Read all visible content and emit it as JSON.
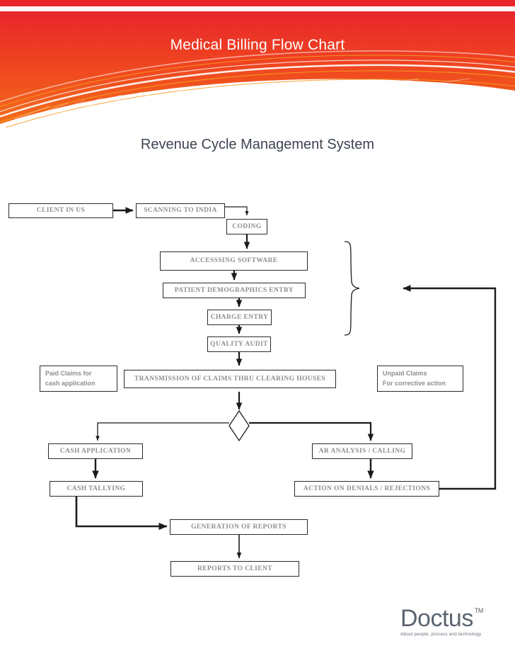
{
  "header": {
    "title": "Medical Billing Flow Chart",
    "subtitle": "Revenue Cycle Management System",
    "colors": {
      "top_bar_red": "#e8262c",
      "banner_red": "#e8262c",
      "banner_orange": "#f26a1b",
      "swoosh_white": "#ffffff",
      "swoosh_orange": "#f59a22",
      "subtitle_text": "#3d4450"
    }
  },
  "flowchart": {
    "node_text_color": "#8e8e93",
    "line_color": "#1b1b1b",
    "nodes": [
      {
        "id": "client-in-us",
        "label": "CLIENT IN US"
      },
      {
        "id": "scanning-to-india",
        "label": "SCANNING TO INDIA"
      },
      {
        "id": "coding",
        "label": "CODING"
      },
      {
        "id": "accesssing-software",
        "label": "ACCESSSING SOFTWARE"
      },
      {
        "id": "patient-demographics-entry",
        "label": "PATIENT DEMOGRAPHICS ENTRY"
      },
      {
        "id": "charge-entry",
        "label": "CHARGE ENTRY"
      },
      {
        "id": "quality-audit",
        "label": "QUALITY AUDIT"
      },
      {
        "id": "paid-claims-note",
        "label_line1": "Paid Claims for",
        "label_line2": "cash application"
      },
      {
        "id": "transmission-of-claims",
        "label": "TRANSMISSION OF CLAIMS THRU CLEARING HOUSES"
      },
      {
        "id": "unpaid-claims-note",
        "label_line1": "Unpaid Claims",
        "label_line2": "For corrective action"
      },
      {
        "id": "cash-application",
        "label": "CASH APPLICATION"
      },
      {
        "id": "ar-analysis-calling",
        "label": "AR ANALYSIS / CALLING"
      },
      {
        "id": "cash-tallying",
        "label": "CASH TALLYING"
      },
      {
        "id": "action-on-denials",
        "label": "ACTION ON DENIALS / REJECTIONS"
      },
      {
        "id": "generation-of-reports",
        "label": "GENERATION OF REPORTS"
      },
      {
        "id": "reports-to-client",
        "label": "REPORTS TO CLIENT"
      }
    ]
  },
  "logo": {
    "wordmark": "Doctus",
    "trademark": "TM",
    "tagline": "About people, process and technology",
    "color": "#5c6470"
  }
}
